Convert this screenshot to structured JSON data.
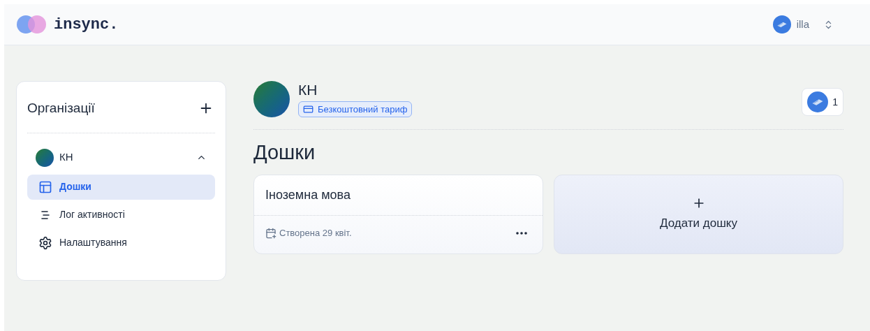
{
  "header": {
    "logo": "insync.",
    "user": {
      "name": "illa"
    }
  },
  "sidebar": {
    "title": "Організації",
    "organizations": [
      {
        "name": "КН",
        "expanded": true,
        "items": [
          {
            "kind": "boards",
            "label": "Дошки",
            "selected": true
          },
          {
            "kind": "activity",
            "label": "Лог активності",
            "selected": false
          },
          {
            "kind": "settings",
            "label": "Налаштування",
            "selected": false
          }
        ]
      }
    ]
  },
  "organization": {
    "name": "КН",
    "plan": "Безкоштовний тариф",
    "members_count": "1"
  },
  "boards_title": "Дошки",
  "boards": [
    {
      "title": "Іноземна мова",
      "created": "Створена 29 квіт."
    }
  ],
  "add_board": {
    "label": "Додати дошку"
  }
}
